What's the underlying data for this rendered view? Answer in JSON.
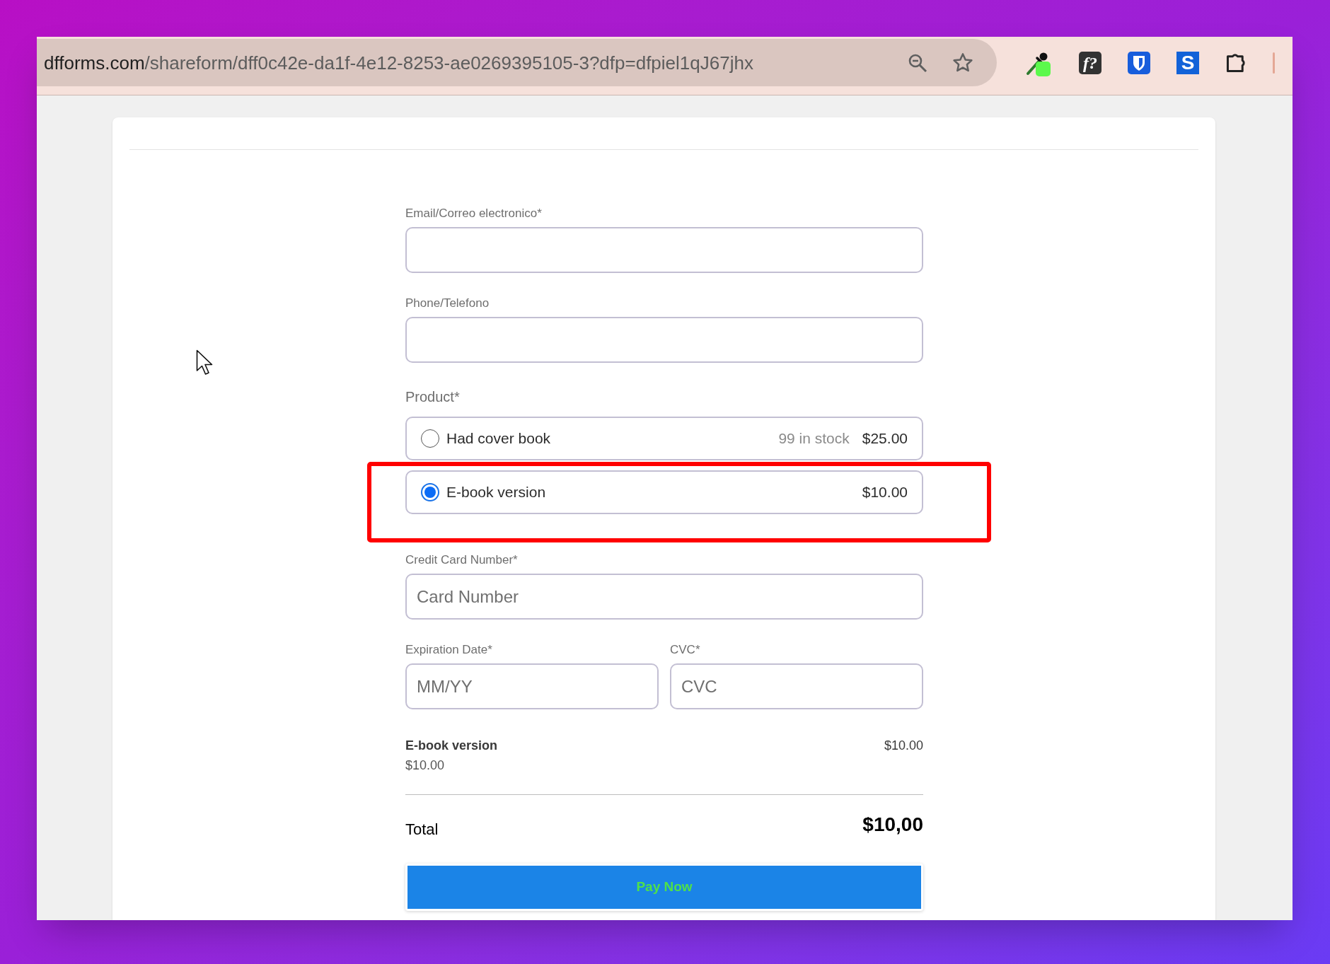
{
  "browser": {
    "url": {
      "host": "dfforms.com",
      "path": "/shareform/dff0c42e-da1f-4e12-8253-ae0269395105-3?dfp=dfpiel1qJ67jhx"
    },
    "extensions": [
      {
        "kind": "eyedropper"
      },
      {
        "kind": "serif-tile",
        "text": "f?",
        "color": "#333333"
      },
      {
        "kind": "shield"
      },
      {
        "kind": "sans-tile",
        "text": "S",
        "color": "#1262d8"
      }
    ]
  },
  "form": {
    "fields": [
      {
        "label": "Email/Correo electronico*"
      },
      {
        "label": "Phone/Telefono"
      }
    ],
    "product": {
      "label": "Product*",
      "options": [
        {
          "name": "Had cover book",
          "stock": "99 in stock",
          "price": "$25.00",
          "selected": false
        },
        {
          "name": "E-book version",
          "price": "$10.00",
          "selected": true
        }
      ]
    },
    "card_number": {
      "label": "Credit Card Number*",
      "placeholder": "Card Number"
    },
    "expiry": {
      "label": "Expiration Date*",
      "placeholder": "MM/YY"
    },
    "cvc": {
      "label": "CVC*",
      "placeholder": "CVC"
    }
  },
  "summary": {
    "items": [
      {
        "name": "E-book version",
        "unit_price": "$10.00",
        "amount": "$10.00"
      }
    ],
    "total_label": "Total",
    "total": "$10,00"
  },
  "pay_button": {
    "label": "Pay Now"
  }
}
